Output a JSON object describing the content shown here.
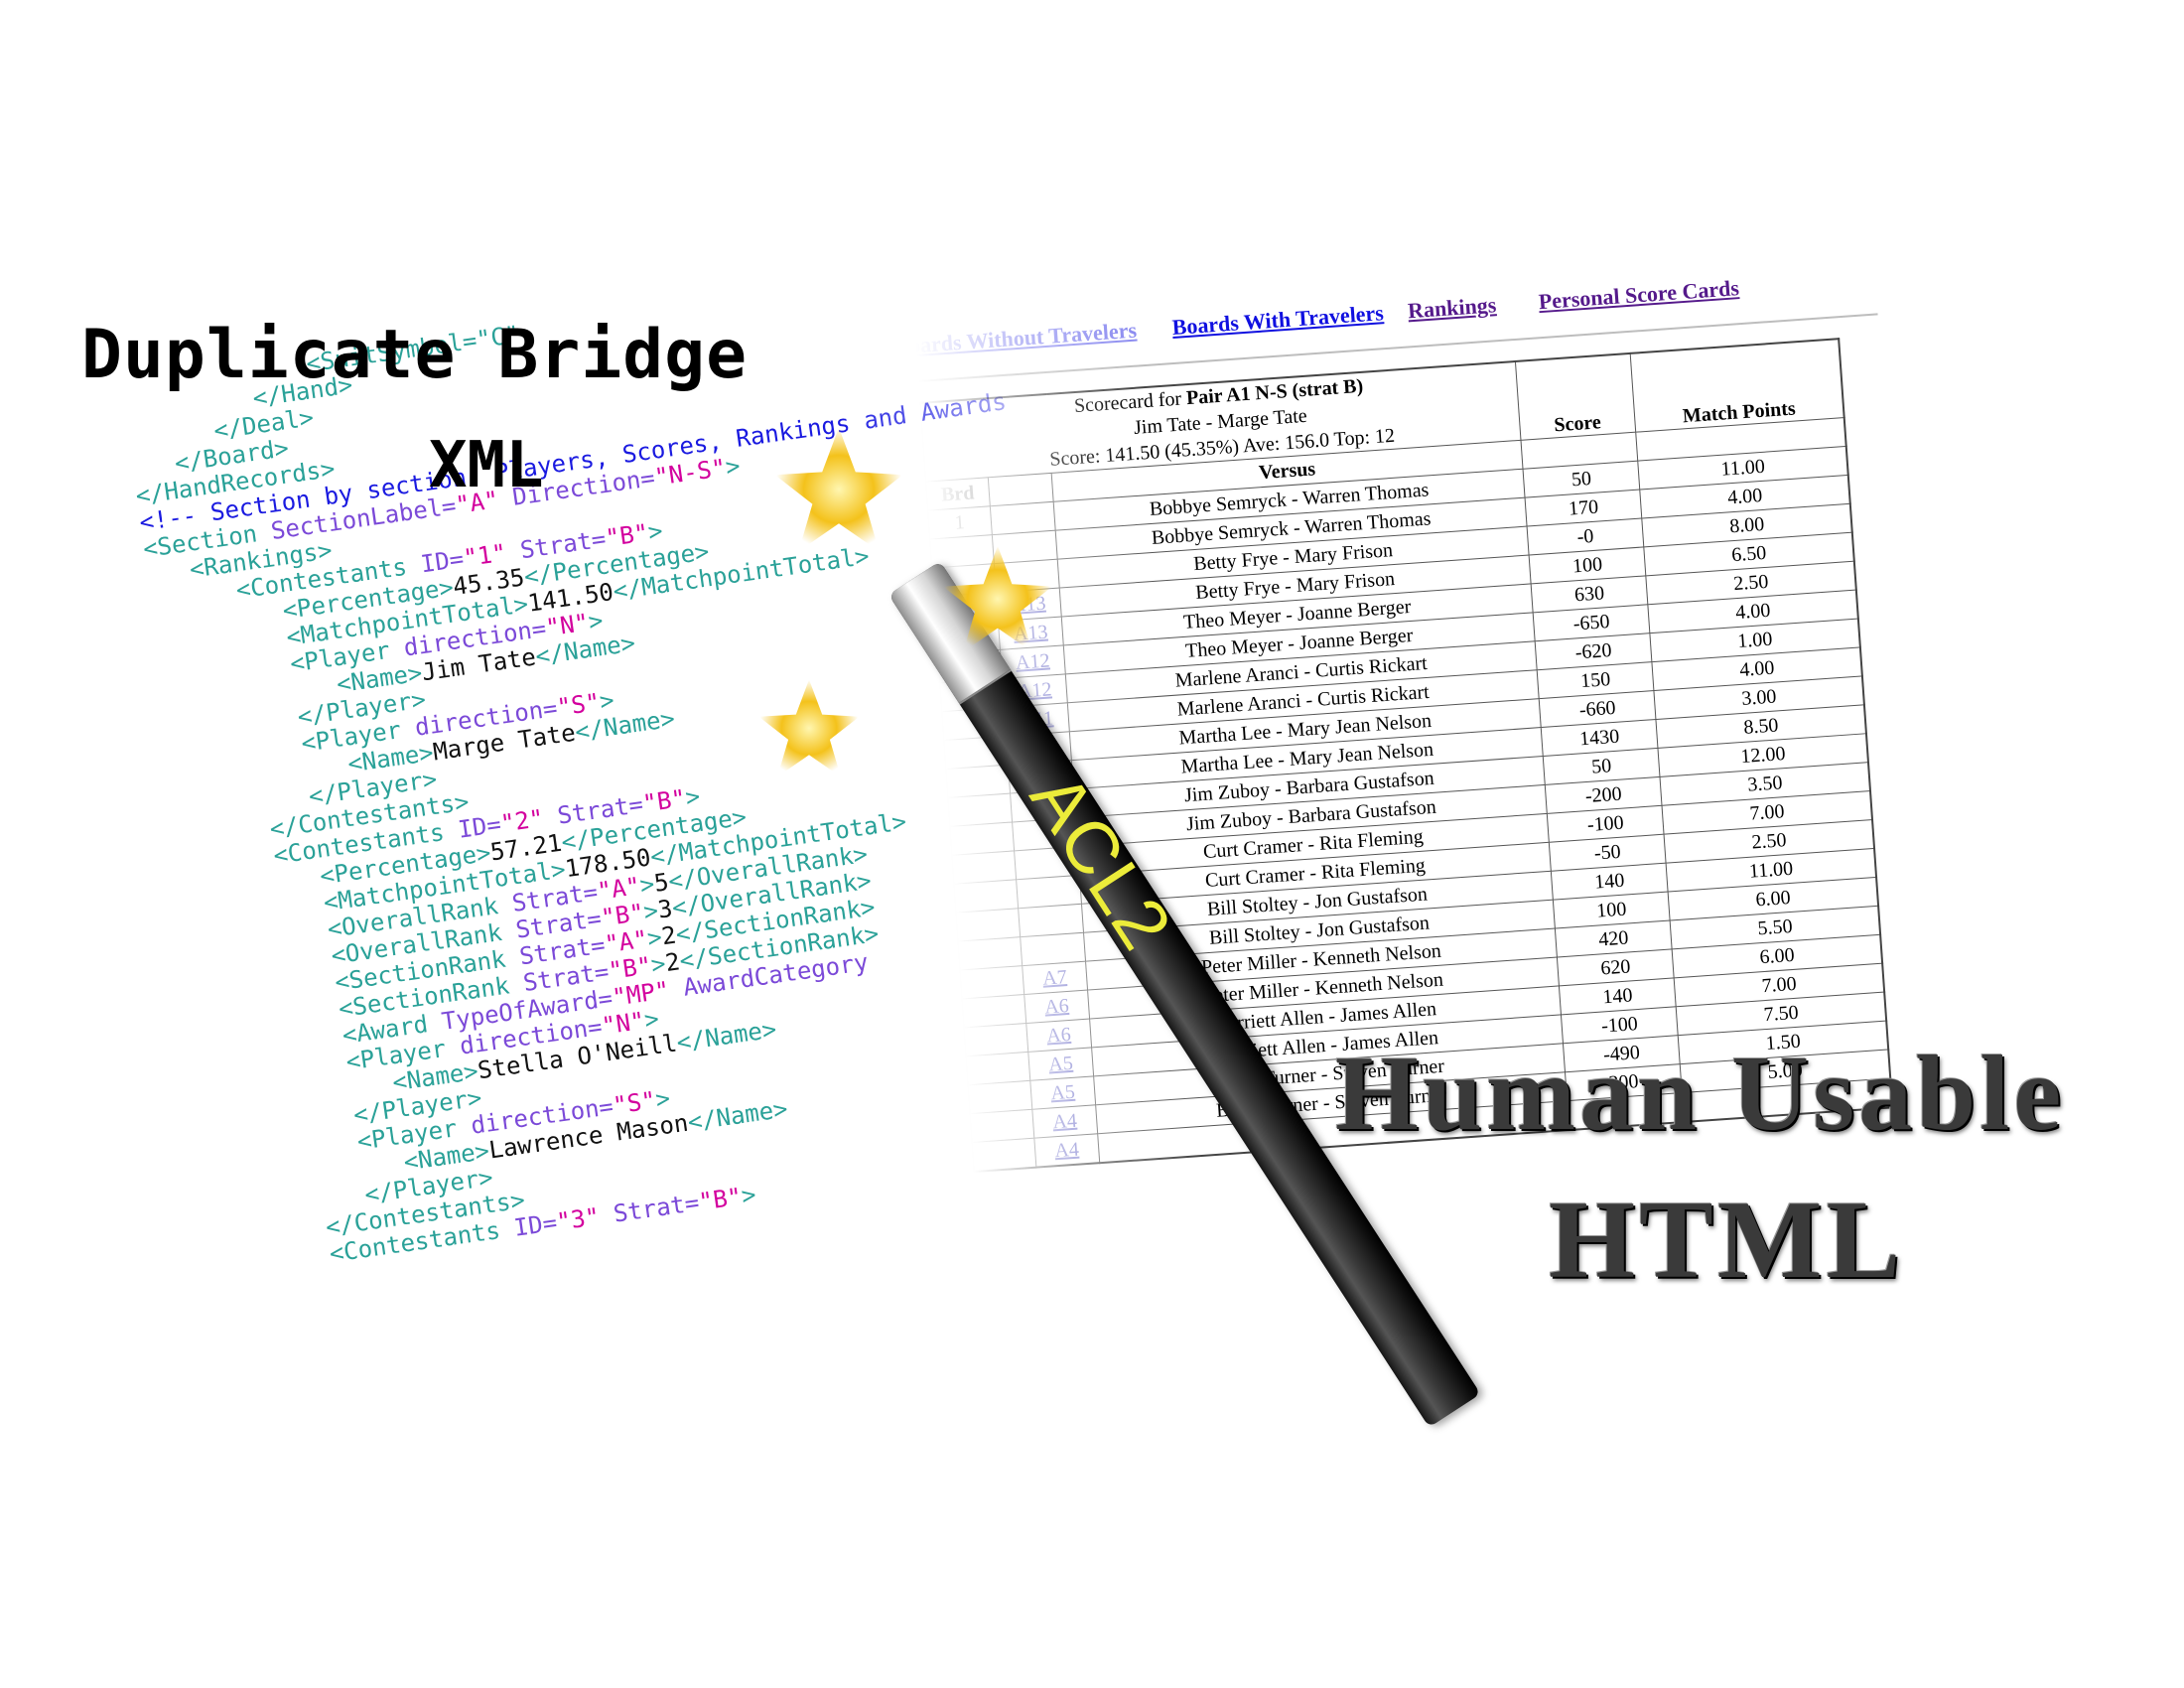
{
  "titles": {
    "duplicate_bridge": "Duplicate Bridge",
    "xml": "XML",
    "human_usable": "Human Usable",
    "html": "HTML"
  },
  "xml_lines": [
    {
      "indent": 13,
      "parts": [
        [
          "t",
          "<SuitSymbol=\"C\""
        ]
      ]
    },
    {
      "indent": 9,
      "parts": [
        [
          "t",
          "</Hand>"
        ]
      ]
    },
    {
      "indent": 6,
      "parts": [
        [
          "t",
          "</Deal>"
        ]
      ]
    },
    {
      "indent": 3,
      "parts": [
        [
          "t",
          "</Board>"
        ]
      ]
    },
    {
      "indent": 0,
      "parts": [
        [
          "t",
          "</HandRecords>"
        ]
      ]
    },
    {
      "indent": 0,
      "parts": [
        [
          "c",
          "<!-- Section by section: Players, Scores, Rankings and Awards"
        ]
      ]
    },
    {
      "indent": 0,
      "parts": [
        [
          "t",
          "<Section "
        ],
        [
          "a",
          "SectionLabel="
        ],
        [
          "v",
          "\"A\""
        ],
        [
          "a",
          " Direction="
        ],
        [
          "v",
          "\"N-S\""
        ],
        [
          "t",
          ">"
        ]
      ]
    },
    {
      "indent": 3,
      "parts": [
        [
          "t",
          "<Rankings>"
        ]
      ]
    },
    {
      "indent": 6,
      "parts": [
        [
          "t",
          "<Contestants "
        ],
        [
          "a",
          "ID="
        ],
        [
          "v",
          "\"1\""
        ],
        [
          "a",
          " Strat="
        ],
        [
          "v",
          "\"B\""
        ],
        [
          "t",
          ">"
        ]
      ]
    },
    {
      "indent": 9,
      "parts": [
        [
          "t",
          "<Percentage>"
        ],
        [
          "x",
          "45.35"
        ],
        [
          "t",
          "</Percentage>"
        ]
      ]
    },
    {
      "indent": 9,
      "parts": [
        [
          "t",
          "<MatchpointTotal>"
        ],
        [
          "x",
          "141.50"
        ],
        [
          "t",
          "</MatchpointTotal>"
        ]
      ]
    },
    {
      "indent": 9,
      "parts": [
        [
          "t",
          "<Player "
        ],
        [
          "a",
          "direction="
        ],
        [
          "v",
          "\"N\""
        ],
        [
          "t",
          ">"
        ]
      ]
    },
    {
      "indent": 12,
      "parts": [
        [
          "t",
          "<Name>"
        ],
        [
          "x",
          "Jim Tate"
        ],
        [
          "t",
          "</Name>"
        ]
      ]
    },
    {
      "indent": 9,
      "parts": [
        [
          "t",
          "</Player>"
        ]
      ]
    },
    {
      "indent": 9,
      "parts": [
        [
          "t",
          "<Player "
        ],
        [
          "a",
          "direction="
        ],
        [
          "v",
          "\"S\""
        ],
        [
          "t",
          ">"
        ]
      ]
    },
    {
      "indent": 12,
      "parts": [
        [
          "t",
          "<Name>"
        ],
        [
          "x",
          "Marge Tate"
        ],
        [
          "t",
          "</Name>"
        ]
      ]
    },
    {
      "indent": 9,
      "parts": [
        [
          "t",
          "</Player>"
        ]
      ]
    },
    {
      "indent": 6,
      "parts": [
        [
          "t",
          "</Contestants>"
        ]
      ]
    },
    {
      "indent": 6,
      "parts": [
        [
          "t",
          "<Contestants "
        ],
        [
          "a",
          "ID="
        ],
        [
          "v",
          "\"2\""
        ],
        [
          "a",
          " Strat="
        ],
        [
          "v",
          "\"B\""
        ],
        [
          "t",
          ">"
        ]
      ]
    },
    {
      "indent": 9,
      "parts": [
        [
          "t",
          "<Percentage>"
        ],
        [
          "x",
          "57.21"
        ],
        [
          "t",
          "</Percentage>"
        ]
      ]
    },
    {
      "indent": 9,
      "parts": [
        [
          "t",
          "<MatchpointTotal>"
        ],
        [
          "x",
          "178.50"
        ],
        [
          "t",
          "</MatchpointTotal>"
        ]
      ]
    },
    {
      "indent": 9,
      "parts": [
        [
          "t",
          "<OverallRank "
        ],
        [
          "a",
          "Strat="
        ],
        [
          "v",
          "\"A\""
        ],
        [
          "t",
          ">"
        ],
        [
          "x",
          "5"
        ],
        [
          "t",
          "</OverallRank>"
        ]
      ]
    },
    {
      "indent": 9,
      "parts": [
        [
          "t",
          "<OverallRank "
        ],
        [
          "a",
          "Strat="
        ],
        [
          "v",
          "\"B\""
        ],
        [
          "t",
          ">"
        ],
        [
          "x",
          "3"
        ],
        [
          "t",
          "</OverallRank>"
        ]
      ]
    },
    {
      "indent": 9,
      "parts": [
        [
          "t",
          "<SectionRank "
        ],
        [
          "a",
          "Strat="
        ],
        [
          "v",
          "\"A\""
        ],
        [
          "t",
          ">"
        ],
        [
          "x",
          "2"
        ],
        [
          "t",
          "</SectionRank>"
        ]
      ]
    },
    {
      "indent": 9,
      "parts": [
        [
          "t",
          "<SectionRank "
        ],
        [
          "a",
          "Strat="
        ],
        [
          "v",
          "\"B\""
        ],
        [
          "t",
          ">"
        ],
        [
          "x",
          "2"
        ],
        [
          "t",
          "</SectionRank>"
        ]
      ]
    },
    {
      "indent": 9,
      "parts": [
        [
          "t",
          "<Award "
        ],
        [
          "a",
          "TypeOfAward="
        ],
        [
          "v",
          "\"MP\""
        ],
        [
          "a",
          " AwardCategory"
        ]
      ]
    },
    {
      "indent": 9,
      "parts": [
        [
          "t",
          "<Player "
        ],
        [
          "a",
          "direction="
        ],
        [
          "v",
          "\"N\""
        ],
        [
          "t",
          ">"
        ]
      ]
    },
    {
      "indent": 12,
      "parts": [
        [
          "t",
          "<Name>"
        ],
        [
          "x",
          "Stella O'Neill"
        ],
        [
          "t",
          "</Name>"
        ]
      ]
    },
    {
      "indent": 9,
      "parts": [
        [
          "t",
          "</Player>"
        ]
      ]
    },
    {
      "indent": 9,
      "parts": [
        [
          "t",
          "<Player "
        ],
        [
          "a",
          "direction="
        ],
        [
          "v",
          "\"S\""
        ],
        [
          "t",
          ">"
        ]
      ]
    },
    {
      "indent": 12,
      "parts": [
        [
          "t",
          "<Name>"
        ],
        [
          "x",
          "Lawrence Mason"
        ],
        [
          "t",
          "</Name>"
        ]
      ]
    },
    {
      "indent": 9,
      "parts": [
        [
          "t",
          "</Player>"
        ]
      ]
    },
    {
      "indent": 6,
      "parts": [
        [
          "t",
          "</Contestants>"
        ]
      ]
    },
    {
      "indent": 6,
      "parts": [
        [
          "t",
          "<Contestants "
        ],
        [
          "a",
          "ID="
        ],
        [
          "v",
          "\"3\""
        ],
        [
          "a",
          " Strat="
        ],
        [
          "v",
          "\"B\""
        ],
        [
          "t",
          ">"
        ]
      ]
    }
  ],
  "nav": {
    "boards_without_travelers": "Boards Without Travelers",
    "boards_with_travelers": "Boards With Travelers",
    "rankings": "Rankings",
    "personal_score_cards": "Personal Score Cards"
  },
  "scorecard": {
    "title_prefix": "Scorecard for ",
    "title_pair": "Pair A1 N-S (strat B)",
    "players": "Jim Tate - Marge Tate",
    "summary": "Score: 141.50 (45.35%) Ave: 156.0 Top: 12",
    "col_brd": "Brd",
    "col_versus": "Versus",
    "col_score": "Score",
    "col_match_points": "Match Points",
    "rows": [
      {
        "brd": "1",
        "vs_link": "",
        "versus": "Bobbye Semryck - Warren Thomas",
        "score": "50",
        "mp": "11.00"
      },
      {
        "brd": "",
        "vs_link": "",
        "versus": "Bobbye Semryck - Warren Thomas",
        "score": "170",
        "mp": "4.00"
      },
      {
        "brd": "",
        "vs_link": "",
        "versus": "Betty Frye - Mary Frison",
        "score": "-0",
        "mp": "8.00"
      },
      {
        "brd": "",
        "vs_link": "A13",
        "versus": "Betty Frye - Mary Frison",
        "score": "100",
        "mp": "6.50"
      },
      {
        "brd": "",
        "vs_link": "A13",
        "versus": "Theo Meyer - Joanne Berger",
        "score": "630",
        "mp": "2.50"
      },
      {
        "brd": "",
        "vs_link": "A12",
        "versus": "Theo Meyer - Joanne Berger",
        "score": "-650",
        "mp": "4.00"
      },
      {
        "brd": "",
        "vs_link": "A12",
        "versus": "Marlene Aranci - Curtis Rickart",
        "score": "-620",
        "mp": "1.00"
      },
      {
        "brd": "",
        "vs_link": "A11",
        "versus": "Marlene Aranci - Curtis Rickart",
        "score": "150",
        "mp": "4.00"
      },
      {
        "brd": "",
        "vs_link": "",
        "versus": "Martha Lee - Mary Jean Nelson",
        "score": "-660",
        "mp": "3.00"
      },
      {
        "brd": "",
        "vs_link": "",
        "versus": "Martha Lee - Mary Jean Nelson",
        "score": "1430",
        "mp": "8.50"
      },
      {
        "brd": "",
        "vs_link": "",
        "versus": "Jim Zuboy - Barbara Gustafson",
        "score": "50",
        "mp": "12.00"
      },
      {
        "brd": "",
        "vs_link": "",
        "versus": "Jim Zuboy - Barbara Gustafson",
        "score": "-200",
        "mp": "3.50"
      },
      {
        "brd": "",
        "vs_link": "",
        "versus": "Curt Cramer - Rita Fleming",
        "score": "-100",
        "mp": "7.00"
      },
      {
        "brd": "",
        "vs_link": "",
        "versus": "Curt Cramer - Rita Fleming",
        "score": "-50",
        "mp": "2.50"
      },
      {
        "brd": "",
        "vs_link": "",
        "versus": "Bill Stoltey - Jon Gustafson",
        "score": "140",
        "mp": "11.00"
      },
      {
        "brd": "",
        "vs_link": "",
        "versus": "Bill Stoltey - Jon Gustafson",
        "score": "100",
        "mp": "6.00"
      },
      {
        "brd": "",
        "vs_link": "A7",
        "versus": "Peter Miller - Kenneth Nelson",
        "score": "420",
        "mp": "5.50"
      },
      {
        "brd": "",
        "vs_link": "A6",
        "versus": "Peter Miller - Kenneth Nelson",
        "score": "620",
        "mp": "6.00"
      },
      {
        "brd": "",
        "vs_link": "A6",
        "versus": "Harriett Allen - James Allen",
        "score": "140",
        "mp": "7.00"
      },
      {
        "brd": "",
        "vs_link": "A5",
        "versus": "Harriett Allen - James Allen",
        "score": "-100",
        "mp": "7.50"
      },
      {
        "brd": "",
        "vs_link": "A5",
        "versus": "Billie Turner - Steven Turner",
        "score": "-490",
        "mp": "1.50"
      },
      {
        "brd": "",
        "vs_link": "A4",
        "versus": "Billie Turner - Steven Turner",
        "score": "200",
        "mp": "5.00"
      },
      {
        "brd": "",
        "vs_link": "A4",
        "versus": "",
        "score": "",
        "mp": ""
      }
    ]
  },
  "wand": {
    "label": "ACL2"
  },
  "colors": {
    "xml_tag": "#2aa198",
    "xml_attr": "#7b49d8",
    "xml_value": "#d3009e",
    "xml_comment": "#1a1ae0",
    "star": "#f4c21b",
    "wand_label": "#ecec3a"
  }
}
